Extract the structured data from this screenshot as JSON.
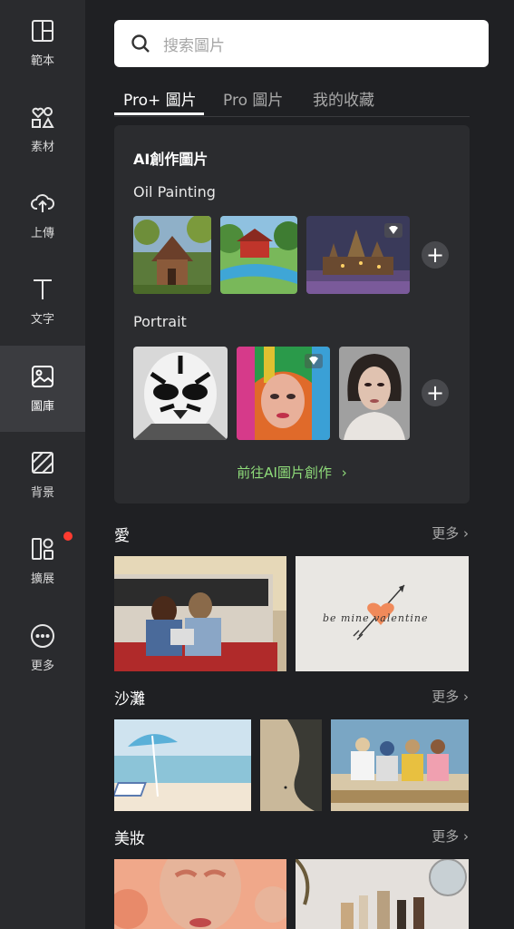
{
  "sidebar": {
    "items": [
      {
        "label": "範本",
        "icon": "template-icon"
      },
      {
        "label": "素材",
        "icon": "elements-icon"
      },
      {
        "label": "上傳",
        "icon": "upload-icon"
      },
      {
        "label": "文字",
        "icon": "text-icon"
      },
      {
        "label": "圖庫",
        "icon": "gallery-icon",
        "active": true
      },
      {
        "label": "背景",
        "icon": "background-icon"
      },
      {
        "label": "擴展",
        "icon": "extensions-icon",
        "badge": true
      },
      {
        "label": "更多",
        "icon": "more-icon"
      }
    ]
  },
  "search": {
    "placeholder": "搜索圖片"
  },
  "tabs": [
    {
      "label": "Pro+ 圖片",
      "active": true
    },
    {
      "label": "Pro 圖片"
    },
    {
      "label": "我的收藏"
    }
  ],
  "ai_card": {
    "title": "AI創作圖片",
    "groups": [
      {
        "label": "Oil Painting"
      },
      {
        "label": "Portrait"
      }
    ],
    "link": "前往AI圖片創作"
  },
  "sections": [
    {
      "title": "愛",
      "more": "更多"
    },
    {
      "title": "沙灘",
      "more": "更多"
    },
    {
      "title": "美妝",
      "more": "更多"
    }
  ],
  "colors": {
    "accent_green": "#8fdc7a",
    "badge_red": "#ff3b30",
    "panel": "#2b2c2f"
  },
  "images": {
    "valentine_text": "be mine valentine"
  }
}
